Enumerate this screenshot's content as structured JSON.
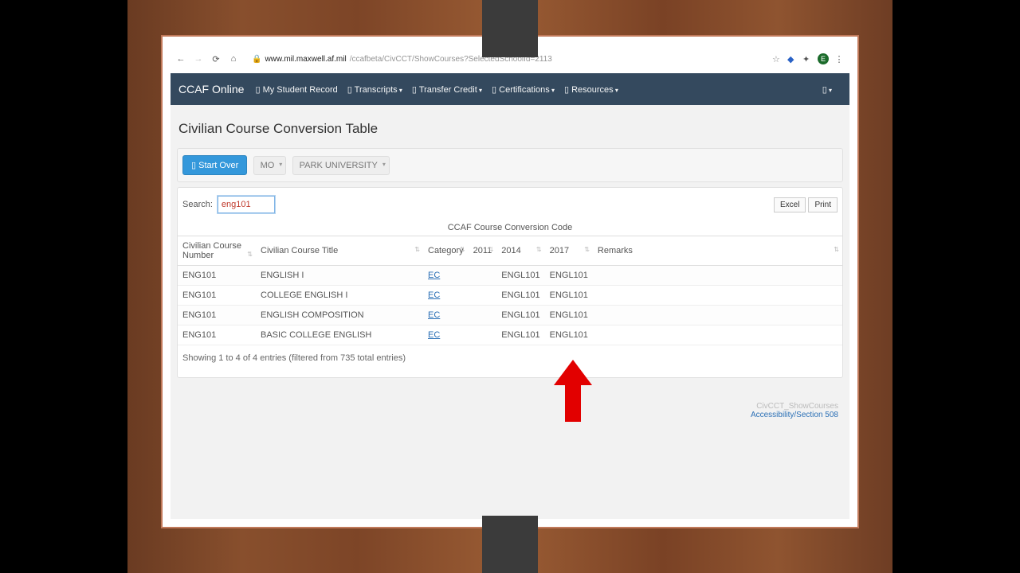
{
  "browser": {
    "url_host": "www.mil.maxwell.af.mil",
    "url_path": "/ccafbeta/CivCCT/ShowCourses?SelectedSchoolId=2113",
    "avatar_letter": "E"
  },
  "nav": {
    "brand": "CCAF Online",
    "items": [
      {
        "label": "My Student Record"
      },
      {
        "label": "Transcripts"
      },
      {
        "label": "Transfer Credit"
      },
      {
        "label": "Certifications"
      },
      {
        "label": "Resources"
      }
    ]
  },
  "page": {
    "title": "Civilian Course Conversion Table",
    "start_over": "Start Over",
    "state_sel": "MO",
    "school_sel": "PARK UNIVERSITY",
    "search_label": "Search:",
    "search_value": "eng101",
    "excel_btn": "Excel",
    "print_btn": "Print",
    "caption": "CCAF Course Conversion Code",
    "columns": [
      "Civilian Course Number",
      "Civilian Course Title",
      "Category",
      "2011",
      "2014",
      "2017",
      "Remarks"
    ],
    "rows": [
      {
        "num": "ENG101",
        "title": "ENGLISH I",
        "cat": "EC",
        "y11": "",
        "y14": "ENGL101",
        "y17": "ENGL101",
        "rem": ""
      },
      {
        "num": "ENG101",
        "title": "COLLEGE ENGLISH I",
        "cat": "EC",
        "y11": "",
        "y14": "ENGL101",
        "y17": "ENGL101",
        "rem": ""
      },
      {
        "num": "ENG101",
        "title": "ENGLISH COMPOSITION",
        "cat": "EC",
        "y11": "",
        "y14": "ENGL101",
        "y17": "ENGL101",
        "rem": ""
      },
      {
        "num": "ENG101",
        "title": "BASIC COLLEGE ENGLISH",
        "cat": "EC",
        "y11": "",
        "y14": "ENGL101",
        "y17": "ENGL101",
        "rem": ""
      }
    ],
    "entries_info": "Showing 1 to 4 of 4 entries (filtered from 735 total entries)",
    "footer_crumb": "CivCCT_ShowCourses",
    "footer_link": "Accessibility/Section 508"
  }
}
